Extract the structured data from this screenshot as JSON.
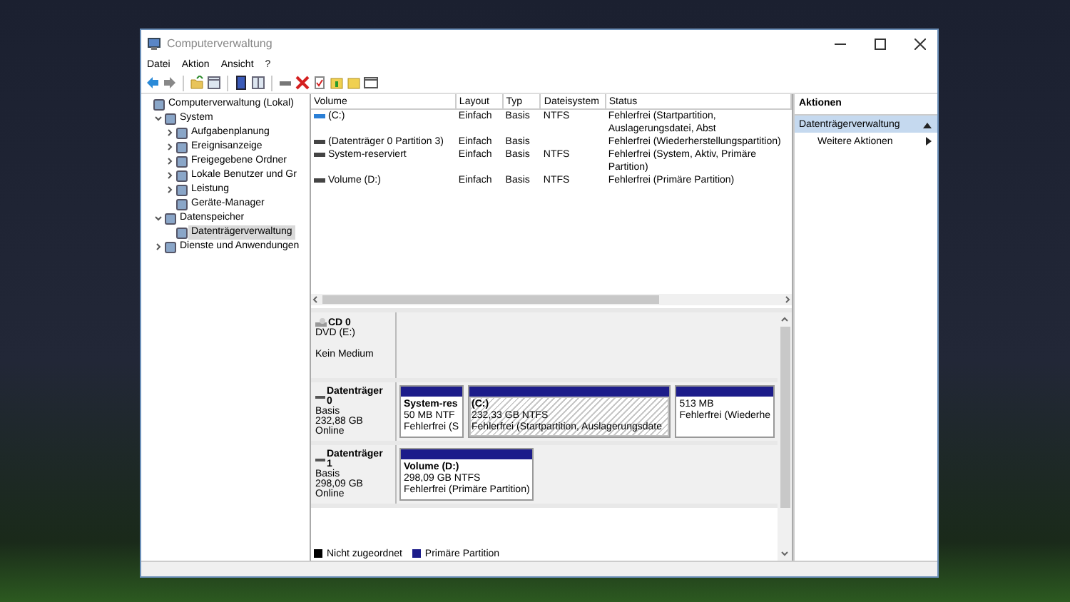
{
  "window": {
    "title": "Computerverwaltung"
  },
  "menu": [
    "Datei",
    "Aktion",
    "Ansicht",
    "?"
  ],
  "tree": [
    {
      "label": "Computerverwaltung (Lokal)",
      "selected": false,
      "children": [
        {
          "label": "System",
          "expanded": true,
          "selected": false,
          "children": [
            {
              "label": "Aufgabenplanung",
              "expanded": false,
              "selected": false
            },
            {
              "label": "Ereignisanzeige",
              "expanded": false,
              "selected": false
            },
            {
              "label": "Freigegebene Ordner",
              "expanded": false,
              "selected": false
            },
            {
              "label": "Lokale Benutzer und Gr",
              "expanded": false,
              "selected": false
            },
            {
              "label": "Leistung",
              "expanded": false,
              "selected": false
            },
            {
              "label": "Geräte-Manager",
              "selected": false
            }
          ]
        },
        {
          "label": "Datenspeicher",
          "expanded": true,
          "selected": false,
          "children": [
            {
              "label": "Datenträgerverwaltung",
              "selected": true
            }
          ]
        },
        {
          "label": "Dienste und Anwendungen",
          "expanded": false,
          "selected": false
        }
      ]
    }
  ],
  "volumes": {
    "columns": [
      "Volume",
      "Layout",
      "Typ",
      "Dateisystem",
      "Status"
    ],
    "rows": [
      {
        "color": "#2b7fd6",
        "volume": "(C:)",
        "layout": "Einfach",
        "type": "Basis",
        "filesystem": "NTFS",
        "status": "Fehlerfrei (Startpartition, Auslagerungsdatei, Abst"
      },
      {
        "color": "#444444",
        "volume": "(Datenträger 0 Partition 3)",
        "layout": "Einfach",
        "type": "Basis",
        "status": "Fehlerfrei (Wiederherstellungspartition)"
      },
      {
        "color": "#444444",
        "volume": "System-reserviert",
        "layout": "Einfach",
        "type": "Basis",
        "filesystem": "NTFS",
        "status": "Fehlerfrei (System, Aktiv, Primäre Partition)"
      },
      {
        "color": "#444444",
        "volume": "Volume (D:)",
        "layout": "Einfach",
        "type": "Basis",
        "filesystem": "NTFS",
        "status": "Fehlerfrei (Primäre Partition)"
      }
    ]
  },
  "disks": [
    {
      "kind": "cd",
      "name": "CD 0",
      "info": [
        "DVD (E:)",
        "Kein Medium"
      ]
    },
    {
      "kind": "disk",
      "name": "Datenträger 0",
      "info": [
        "Basis",
        "232,88 GB",
        "Online"
      ],
      "partitions": [
        {
          "name": "System-res",
          "size": "50 MB NTF",
          "status": "Fehlerfrei (S",
          "selected": false
        },
        {
          "name": "(C:)",
          "size": "232,33 GB NTFS",
          "status": "Fehlerfrei (Startpartition, Auslagerungsdate",
          "selected": true
        },
        {
          "size": "513 MB",
          "status": "Fehlerfrei (Wiederhe",
          "selected": false
        }
      ]
    },
    {
      "kind": "disk",
      "name": "Datenträger 1",
      "info": [
        "Basis",
        "298,09 GB",
        "Online"
      ],
      "partitions": [
        {
          "name": "Volume (D:)",
          "size": "298,09 GB NTFS",
          "status": "Fehlerfrei (Primäre Partition)",
          "selected": false
        }
      ]
    }
  ],
  "legend": [
    {
      "label": "Nicht zugeordnet",
      "color": "#000000"
    },
    {
      "label": "Primäre Partition",
      "color": "#1c1c8a"
    }
  ],
  "actions": {
    "header": "Aktionen",
    "sections": [
      {
        "title": "Datenträgerverwaltung",
        "expanded": true,
        "items": [
          "Weitere Aktionen"
        ]
      }
    ]
  }
}
